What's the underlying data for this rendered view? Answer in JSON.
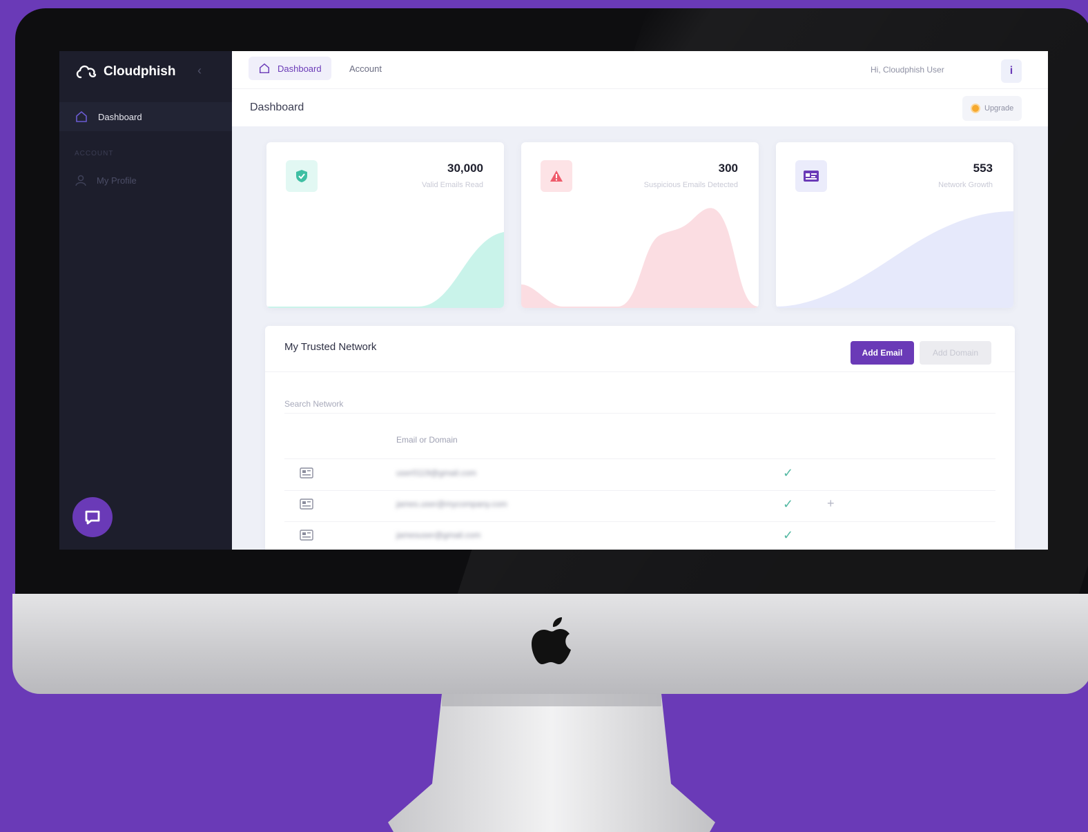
{
  "app": {
    "brand": "Cloudphish"
  },
  "sidebar": {
    "items": [
      {
        "label": "Dashboard",
        "icon": "home-icon"
      }
    ],
    "section": "ACCOUNT",
    "account_items": [
      {
        "label": "My Profile",
        "icon": "user-icon"
      }
    ]
  },
  "topbar": {
    "tabs": [
      {
        "label": "Dashboard",
        "icon": "home-icon"
      },
      {
        "label": "Account"
      }
    ],
    "greeting": "Hi, Cloudphish User"
  },
  "header": {
    "title": "Dashboard",
    "upgrade_label": "Upgrade"
  },
  "stats": [
    {
      "value": "30,000",
      "label": "Valid Emails Read",
      "icon": "shield-check-icon",
      "color": "#4fd1b8",
      "bg": "#e2f8f3"
    },
    {
      "value": "300",
      "label": "Suspicious Emails Detected",
      "icon": "warning-icon",
      "color": "#ef5b6b",
      "bg": "#fde3e6"
    },
    {
      "value": "553",
      "label": "Network Growth",
      "icon": "id-card-icon",
      "color": "#6a3ab7",
      "bg": "#ebecfb"
    }
  ],
  "network": {
    "title": "My Trusted Network",
    "add_email": "Add Email",
    "add_domain": "Add Domain",
    "search_placeholder": "Search Network",
    "column": "Email or Domain",
    "rows": [
      {
        "email": "user0119@gmail.com"
      },
      {
        "email": "james.user@mycompany.com"
      },
      {
        "email": "jamesuser@gmail.com"
      }
    ]
  },
  "colors": {
    "accent": "#6a3ab7",
    "sidebar_bg": "#1d1e2c",
    "success": "#55b9a3"
  }
}
